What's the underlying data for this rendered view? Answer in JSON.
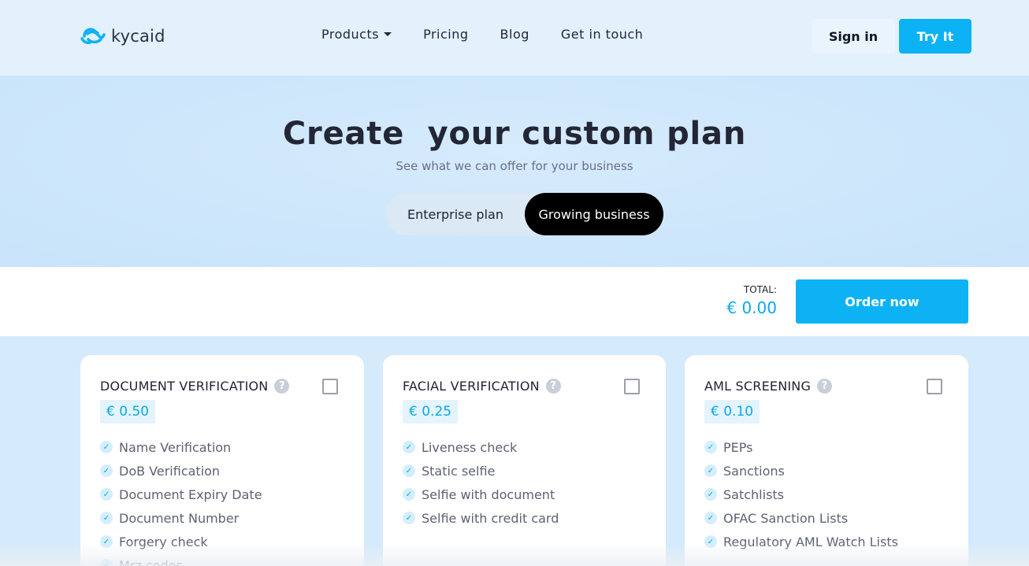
{
  "header": {
    "logo_text": "kycaid",
    "nav": [
      "Products",
      "Pricing",
      "Blog",
      "Get in touch"
    ],
    "signin": "Sign in",
    "try": "Try It"
  },
  "hero": {
    "title": "Create  your custom plan",
    "subtitle": "See what we can offer for your business",
    "plan_enterprise": "Enterprise plan",
    "plan_growing": "Growing business"
  },
  "total": {
    "label": "TOTAL:",
    "value": "€ 0.00",
    "order": "Order now"
  },
  "cards": [
    {
      "title": "DOCUMENT VERIFICATION",
      "price": "€ 0.50",
      "features": [
        "Name Verification",
        "DoB Verification",
        "Document Expiry Date",
        "Document Number",
        "Forgery check",
        "Mrz codes"
      ]
    },
    {
      "title": "FACIAL VERIFICATION",
      "price": "€ 0.25",
      "features": [
        "Liveness check",
        "Static selfie",
        "Selfie with document",
        "Selfie with credit card"
      ]
    },
    {
      "title": "AML SCREENING",
      "price": "€ 0.10",
      "features": [
        "PEPs",
        "Sanctions",
        "Satchlists",
        "OFAC Sanction Lists",
        "Regulatory AML Watch Lists"
      ]
    }
  ],
  "colors": {
    "accent": "#0cb2f4",
    "price_text": "#0aa8ea",
    "toggle_active": "#000000"
  },
  "icons": {
    "help": "?",
    "tick": "✓"
  }
}
